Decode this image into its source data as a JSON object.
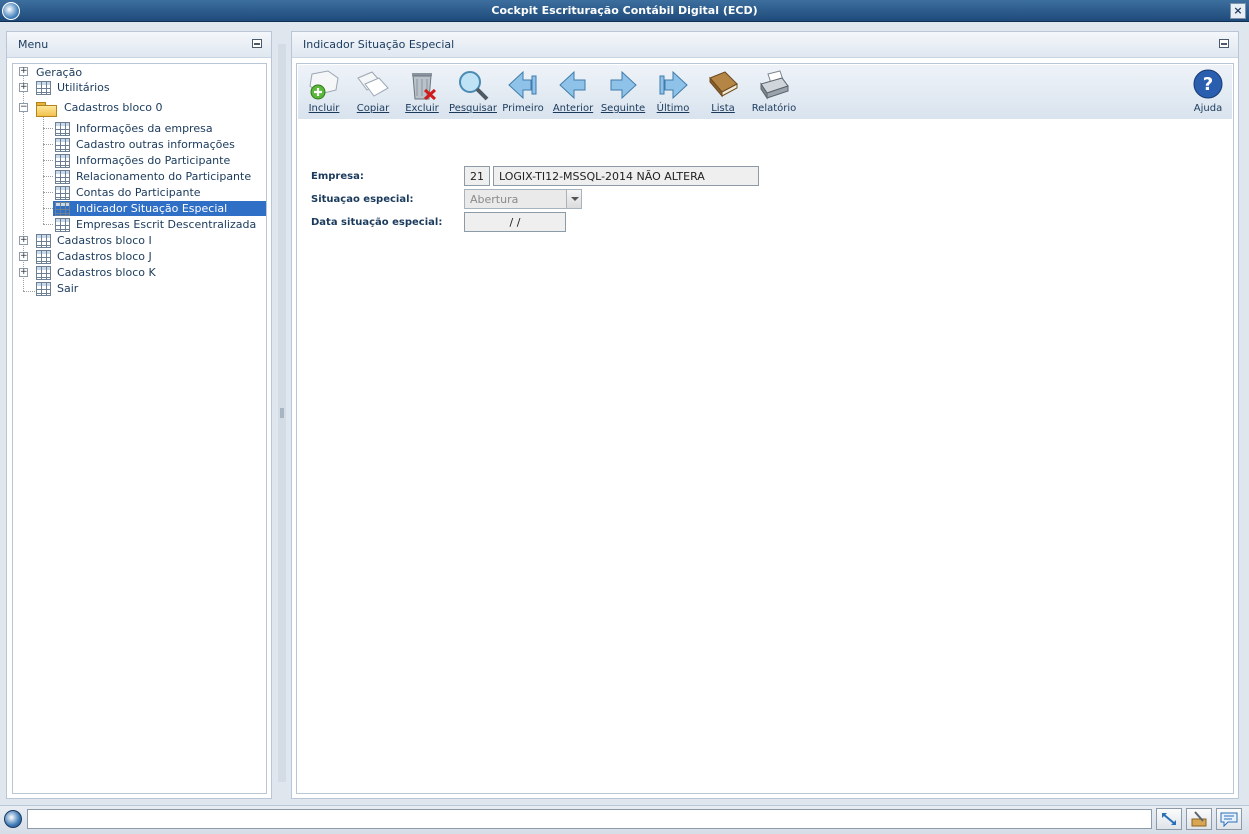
{
  "window": {
    "title": "Cockpit Escrituração Contábil Digital (ECD)"
  },
  "menu": {
    "title": "Menu",
    "items": [
      {
        "label": "Geração"
      },
      {
        "label": "Utilitários"
      },
      {
        "label": "Cadastros bloco 0"
      },
      {
        "label": "Informações da empresa"
      },
      {
        "label": "Cadastro outras informações"
      },
      {
        "label": "Informações do Participante"
      },
      {
        "label": "Relacionamento do Participante"
      },
      {
        "label": "Contas do Participante"
      },
      {
        "label": "Indicador Situação Especial"
      },
      {
        "label": "Empresas Escrit Descentralizada"
      },
      {
        "label": "Cadastros bloco I"
      },
      {
        "label": "Cadastros bloco J"
      },
      {
        "label": "Cadastros bloco K"
      },
      {
        "label": "Sair"
      }
    ]
  },
  "main": {
    "title": "Indicador Situação Especial",
    "toolbar": {
      "incluir": "Incluir",
      "copiar": "Copiar",
      "excluir": "Excluir",
      "pesquisar": "Pesquisar",
      "primeiro": "Primeiro",
      "anterior": "Anterior",
      "seguinte": "Seguinte",
      "ultimo": "Último",
      "lista": "Lista",
      "relatorio": "Relatório",
      "ajuda": "Ajuda"
    },
    "form": {
      "empresa_label": "Empresa:",
      "empresa_code": "21",
      "empresa_name": "LOGIX-TI12-MSSQL-2014 NÃO ALTERA",
      "situacao_label": "Situaçao especial:",
      "situacao_value": "Abertura",
      "data_label": "Data situação especial:",
      "data_value": "/ /"
    }
  }
}
